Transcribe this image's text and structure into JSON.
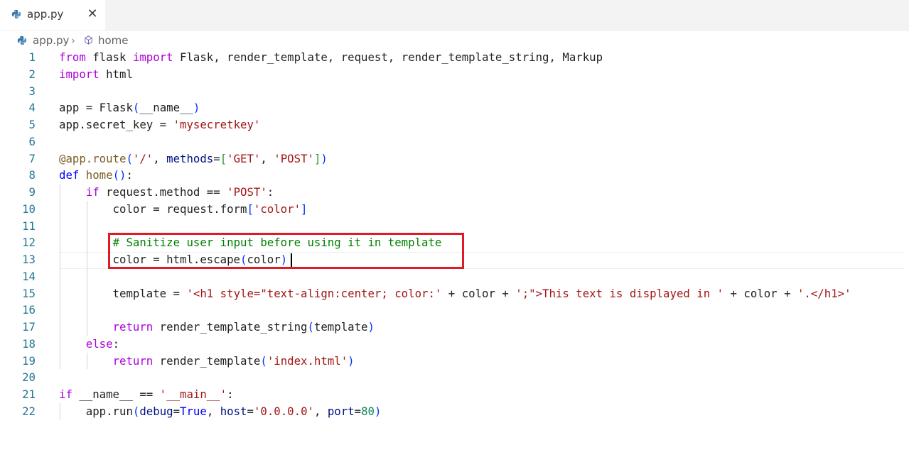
{
  "tab": {
    "label": "app.py",
    "file_icon": "python-icon",
    "close_glyph": "✕"
  },
  "breadcrumb": {
    "file": "app.py",
    "separator": "›",
    "symbol_icon": "method-cube-icon",
    "symbol": "home"
  },
  "editor": {
    "lines": [
      {
        "n": "1",
        "tokens": [
          [
            "kw",
            "from"
          ],
          [
            "txt",
            " flask "
          ],
          [
            "kw",
            "import"
          ],
          [
            "txt",
            " Flask, render_template, request, render_template_string, Markup"
          ]
        ]
      },
      {
        "n": "2",
        "tokens": [
          [
            "kw",
            "import"
          ],
          [
            "txt",
            " html"
          ]
        ]
      },
      {
        "n": "3",
        "tokens": []
      },
      {
        "n": "4",
        "tokens": [
          [
            "txt",
            "app = Flask"
          ],
          [
            "b1",
            "("
          ],
          [
            "txt",
            "__name__"
          ],
          [
            "b1",
            ")"
          ]
        ]
      },
      {
        "n": "5",
        "tokens": [
          [
            "txt",
            "app.secret_key = "
          ],
          [
            "str",
            "'mysecretkey'"
          ]
        ]
      },
      {
        "n": "6",
        "tokens": []
      },
      {
        "n": "7",
        "tokens": [
          [
            "fn",
            "@app.route"
          ],
          [
            "b1",
            "("
          ],
          [
            "str",
            "'/'"
          ],
          [
            "txt",
            ", "
          ],
          [
            "var",
            "methods"
          ],
          [
            "txt",
            "="
          ],
          [
            "b2",
            "["
          ],
          [
            "str",
            "'GET'"
          ],
          [
            "txt",
            ", "
          ],
          [
            "str",
            "'POST'"
          ],
          [
            "b2",
            "]"
          ],
          [
            "b1",
            ")"
          ]
        ]
      },
      {
        "n": "8",
        "tokens": [
          [
            "kw2",
            "def"
          ],
          [
            "txt",
            " "
          ],
          [
            "fn",
            "home"
          ],
          [
            "b1",
            "()"
          ],
          [
            "txt",
            ":"
          ]
        ]
      },
      {
        "n": "9",
        "tokens": [
          [
            "txt",
            "    "
          ],
          [
            "kw",
            "if"
          ],
          [
            "txt",
            " request.method == "
          ],
          [
            "str",
            "'POST'"
          ],
          [
            "txt",
            ":"
          ]
        ]
      },
      {
        "n": "10",
        "tokens": [
          [
            "txt",
            "        color = request.form"
          ],
          [
            "b1",
            "["
          ],
          [
            "str",
            "'color'"
          ],
          [
            "b1",
            "]"
          ]
        ]
      },
      {
        "n": "11",
        "tokens": []
      },
      {
        "n": "12",
        "tokens": [
          [
            "txt",
            "        "
          ],
          [
            "cm",
            "# Sanitize user input before using it in template"
          ]
        ]
      },
      {
        "n": "13",
        "tokens": [
          [
            "txt",
            "        color = html.escape"
          ],
          [
            "b1",
            "("
          ],
          [
            "txt",
            "color"
          ],
          [
            "b1",
            ")"
          ]
        ]
      },
      {
        "n": "14",
        "tokens": []
      },
      {
        "n": "15",
        "tokens": [
          [
            "txt",
            "        template = "
          ],
          [
            "str",
            "'<h1 style=\"text-align:center; color:'"
          ],
          [
            "txt",
            " + color + "
          ],
          [
            "str",
            "';\">This text is displayed in '"
          ],
          [
            "txt",
            " + color + "
          ],
          [
            "str",
            "'.</h1>'"
          ]
        ]
      },
      {
        "n": "16",
        "tokens": []
      },
      {
        "n": "17",
        "tokens": [
          [
            "txt",
            "        "
          ],
          [
            "kw",
            "return"
          ],
          [
            "txt",
            " render_template_string"
          ],
          [
            "b1",
            "("
          ],
          [
            "txt",
            "template"
          ],
          [
            "b1",
            ")"
          ]
        ]
      },
      {
        "n": "18",
        "tokens": [
          [
            "txt",
            "    "
          ],
          [
            "kw",
            "else"
          ],
          [
            "txt",
            ":"
          ]
        ]
      },
      {
        "n": "19",
        "tokens": [
          [
            "txt",
            "        "
          ],
          [
            "kw",
            "return"
          ],
          [
            "txt",
            " render_template"
          ],
          [
            "b1",
            "("
          ],
          [
            "str",
            "'index.html'"
          ],
          [
            "b1",
            ")"
          ]
        ]
      },
      {
        "n": "20",
        "tokens": []
      },
      {
        "n": "21",
        "tokens": [
          [
            "kw",
            "if"
          ],
          [
            "txt",
            " __name__ == "
          ],
          [
            "str",
            "'__main__'"
          ],
          [
            "txt",
            ":"
          ]
        ]
      },
      {
        "n": "22",
        "tokens": [
          [
            "txt",
            "    app.run"
          ],
          [
            "b1",
            "("
          ],
          [
            "var",
            "debug"
          ],
          [
            "txt",
            "="
          ],
          [
            "kw2",
            "True"
          ],
          [
            "txt",
            ", "
          ],
          [
            "var",
            "host"
          ],
          [
            "txt",
            "="
          ],
          [
            "str",
            "'0.0.0.0'"
          ],
          [
            "txt",
            ", "
          ],
          [
            "var",
            "port"
          ],
          [
            "txt",
            "="
          ],
          [
            "num",
            "80"
          ],
          [
            "b1",
            ")"
          ]
        ]
      }
    ]
  },
  "colors": {
    "highlight_box": "#e01b24",
    "line_number": "#237893",
    "keyword": "#af00db",
    "string": "#a31515",
    "comment": "#008000"
  }
}
